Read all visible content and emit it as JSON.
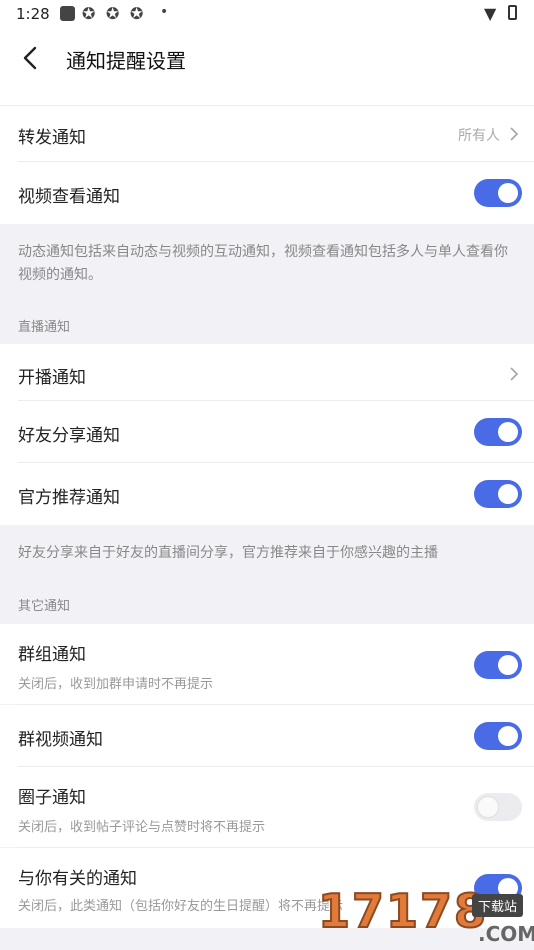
{
  "status_bar": {
    "time": "1:28"
  },
  "header": {
    "title": "通知提醒设置"
  },
  "group1": {
    "forward": {
      "label": "转发通知",
      "value": "所有人"
    },
    "video_view": {
      "label": "视频查看通知",
      "enabled": true
    },
    "note": "动态通知包括来自动态与视频的互动通知，视频查看通知包括多人与单人查看你视频的通知。"
  },
  "live": {
    "section_title": "直播通知",
    "start": {
      "label": "开播通知"
    },
    "friend_share": {
      "label": "好友分享通知",
      "enabled": true
    },
    "official": {
      "label": "官方推荐通知",
      "enabled": true
    },
    "note": "好友分享来自于好友的直播间分享，官方推荐来自于你感兴趣的主播"
  },
  "other": {
    "section_title": "其它通知",
    "group": {
      "label": "群组通知",
      "desc": "关闭后，收到加群申请时不再提示",
      "enabled": true
    },
    "group_video": {
      "label": "群视频通知",
      "enabled": true
    },
    "circle": {
      "label": "圈子通知",
      "desc": "关闭后，收到帖子评论与点赞时将不再提示",
      "enabled": false
    },
    "related": {
      "label": "与你有关的通知",
      "desc": "关闭后，此类通知（包括你好友的生日提醒）将不再提示",
      "enabled": true
    }
  },
  "watermark": {
    "text": "17178",
    "badge": "下载站",
    "domain": ".COM"
  },
  "colors": {
    "accent": "#4a6be6",
    "toggle_off": "#ececef"
  }
}
